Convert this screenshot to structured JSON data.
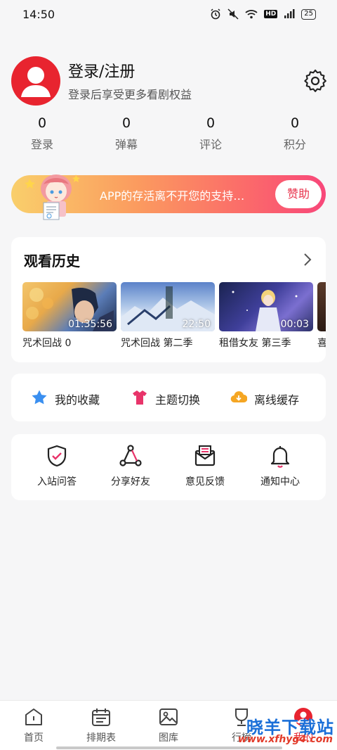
{
  "status_bar": {
    "time": "14:50",
    "network": "4G",
    "battery": "25",
    "hd": "HD"
  },
  "profile": {
    "title": "登录/注册",
    "subtitle": "登录后享受更多看剧权益"
  },
  "stats": [
    {
      "value": "0",
      "label": "登录"
    },
    {
      "value": "0",
      "label": "弹幕"
    },
    {
      "value": "0",
      "label": "评论"
    },
    {
      "value": "0",
      "label": "积分"
    }
  ],
  "banner": {
    "text": "APP的存活离不开您的支持…",
    "button": "赞助"
  },
  "history": {
    "title": "观看历史",
    "items": [
      {
        "title": "咒术回战 0",
        "duration": "01:35:56"
      },
      {
        "title": "咒术回战 第二季",
        "duration": "22:50"
      },
      {
        "title": "租借女友 第三季",
        "duration": "00:03"
      },
      {
        "title": "喜"
      }
    ]
  },
  "quick_actions": [
    {
      "label": "我的收藏",
      "icon": "star-icon",
      "color": "#3a8ff0"
    },
    {
      "label": "主题切换",
      "icon": "shirt-icon",
      "color": "#e8346a"
    },
    {
      "label": "离线缓存",
      "icon": "cloud-download-icon",
      "color": "#f5a623"
    }
  ],
  "tools": [
    {
      "label": "入站问答",
      "icon": "shield-check-icon"
    },
    {
      "label": "分享好友",
      "icon": "share-icon"
    },
    {
      "label": "意见反馈",
      "icon": "mail-icon"
    },
    {
      "label": "通知中心",
      "icon": "bell-icon"
    }
  ],
  "tabs": [
    {
      "label": "首页",
      "icon": "home-icon"
    },
    {
      "label": "排期表",
      "icon": "calendar-icon"
    },
    {
      "label": "图库",
      "icon": "image-icon"
    },
    {
      "label": "行榜",
      "icon": "ranking-icon"
    },
    {
      "label": "我的",
      "icon": "profile-icon",
      "active": true
    }
  ],
  "watermark": {
    "text": "晓羊下载站",
    "url": "www.xfhyg4.com"
  },
  "colors": {
    "accent": "#e8242f",
    "banner_start": "#f9cf6b",
    "banner_end": "#f8477a"
  }
}
